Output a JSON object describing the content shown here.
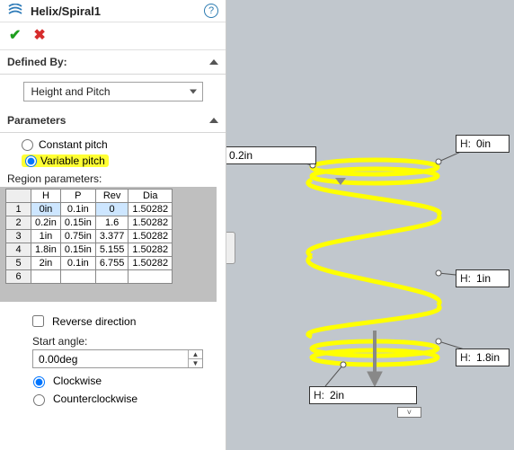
{
  "title": "Helix/Spiral1",
  "definedBy": {
    "header": "Defined By:",
    "selected": "Height and Pitch"
  },
  "parameters": {
    "header": "Parameters",
    "pitchOptions": {
      "constant": "Constant pitch",
      "variable": "Variable pitch",
      "selected": "variable"
    },
    "regionHeader": "Region parameters:",
    "columns": [
      "H",
      "P",
      "Rev",
      "Dia"
    ],
    "rows": [
      {
        "idx": "1",
        "H": "0in",
        "P": "0.1in",
        "Rev": "0",
        "Dia": "1.50282"
      },
      {
        "idx": "2",
        "H": "0.2in",
        "P": "0.15in",
        "Rev": "1.6",
        "Dia": "1.50282"
      },
      {
        "idx": "3",
        "H": "1in",
        "P": "0.75in",
        "Rev": "3.377",
        "Dia": "1.50282"
      },
      {
        "idx": "4",
        "H": "1.8in",
        "P": "0.15in",
        "Rev": "5.155",
        "Dia": "1.50282"
      },
      {
        "idx": "5",
        "H": "2in",
        "P": "0.1in",
        "Rev": "6.755",
        "Dia": "1.50282"
      },
      {
        "idx": "6",
        "H": "",
        "P": "",
        "Rev": "",
        "Dia": ""
      }
    ],
    "reverseDirection": "Reverse direction",
    "startAngle": {
      "label": "Start angle:",
      "value": "0.00deg"
    },
    "rotation": {
      "cw": "Clockwise",
      "ccw": "Counterclockwise",
      "selected": "cw"
    }
  },
  "callouts": [
    {
      "label": "H:",
      "value": "0.2in"
    },
    {
      "label": "H:",
      "value": "0in"
    },
    {
      "label": "H:",
      "value": "1in"
    },
    {
      "label": "H:",
      "value": "1.8in"
    },
    {
      "label": "H:",
      "value": "2in"
    }
  ]
}
